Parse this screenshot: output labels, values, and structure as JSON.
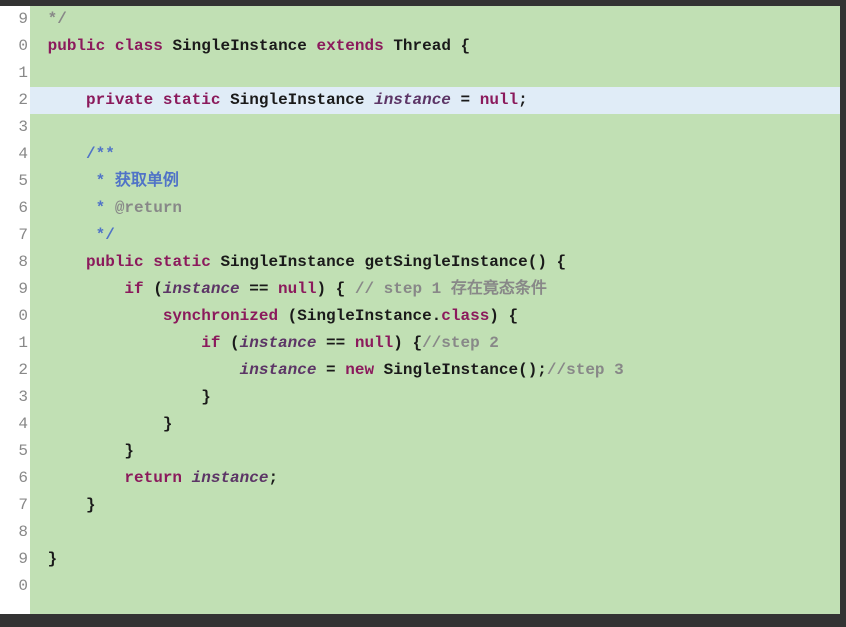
{
  "gutter": {
    "numbers": [
      "9",
      "0",
      "1",
      "2",
      "3",
      "4",
      "5",
      "6",
      "7",
      "8",
      "9",
      "0",
      "1",
      "2",
      "3",
      "4",
      "5",
      "6",
      "7",
      "8",
      "9",
      "0",
      ""
    ],
    "fold_rows": [
      5,
      9
    ],
    "fold_glyph": "⊖"
  },
  "highlighted_row": 3,
  "code": {
    "l0": {
      "indent": " ",
      "c1": "*/"
    },
    "l1": {
      "indent": " ",
      "kw1": "public",
      "kw2": "class",
      "type": "SingleInstance",
      "kw3": "extends",
      "sup": "Thread",
      "brace": " {"
    },
    "l2": {
      "blank": ""
    },
    "l3": {
      "indent": "     ",
      "kw1": "private",
      "kw2": "static",
      "type": "SingleInstance",
      "field": "instance",
      "eq": " = ",
      "kw3": "null",
      "semi": ";"
    },
    "l4": {
      "blank": ""
    },
    "l5": {
      "indent": "     ",
      "t": "/**"
    },
    "l6": {
      "indent": "      ",
      "t": "* 获取单例"
    },
    "l7": {
      "indent": "      ",
      "star": "* ",
      "tag": "@return"
    },
    "l8": {
      "indent": "      ",
      "t": "*/"
    },
    "l9": {
      "indent": "     ",
      "kw1": "public",
      "kw2": "static",
      "type": "SingleInstance",
      "method": "getSingleInstance",
      "paren": "() {"
    },
    "l10": {
      "indent": "         ",
      "kw1": "if",
      "open": " (",
      "field": "instance",
      "op": " == ",
      "kw2": "null",
      "close": ") { ",
      "cmt": "// step 1 存在竟态条件"
    },
    "l11": {
      "indent": "             ",
      "kw1": "synchronized",
      "open": " (SingleInstance.",
      "kw2": "class",
      "close": ") {"
    },
    "l12": {
      "indent": "                 ",
      "kw1": "if",
      "open": " (",
      "field": "instance",
      "op": " == ",
      "kw2": "null",
      "close": ") {",
      "cmt": "//step 2"
    },
    "l13": {
      "indent": "                     ",
      "field": "instance",
      "eq": " = ",
      "kw1": "new",
      "type": " SingleInstance();",
      "cmt": "//step 3"
    },
    "l14": {
      "indent": "                 ",
      "t": "}"
    },
    "l15": {
      "indent": "             ",
      "t": "}"
    },
    "l16": {
      "indent": "         ",
      "t": "}"
    },
    "l17": {
      "indent": "         ",
      "kw1": "return",
      "sp": " ",
      "field": "instance",
      "semi": ";"
    },
    "l18": {
      "indent": "     ",
      "t": "}"
    },
    "l19": {
      "blank": ""
    },
    "l20": {
      "indent": " ",
      "t": "}"
    },
    "l21": {
      "blank": ""
    },
    "l22": {
      "blank": ""
    }
  }
}
